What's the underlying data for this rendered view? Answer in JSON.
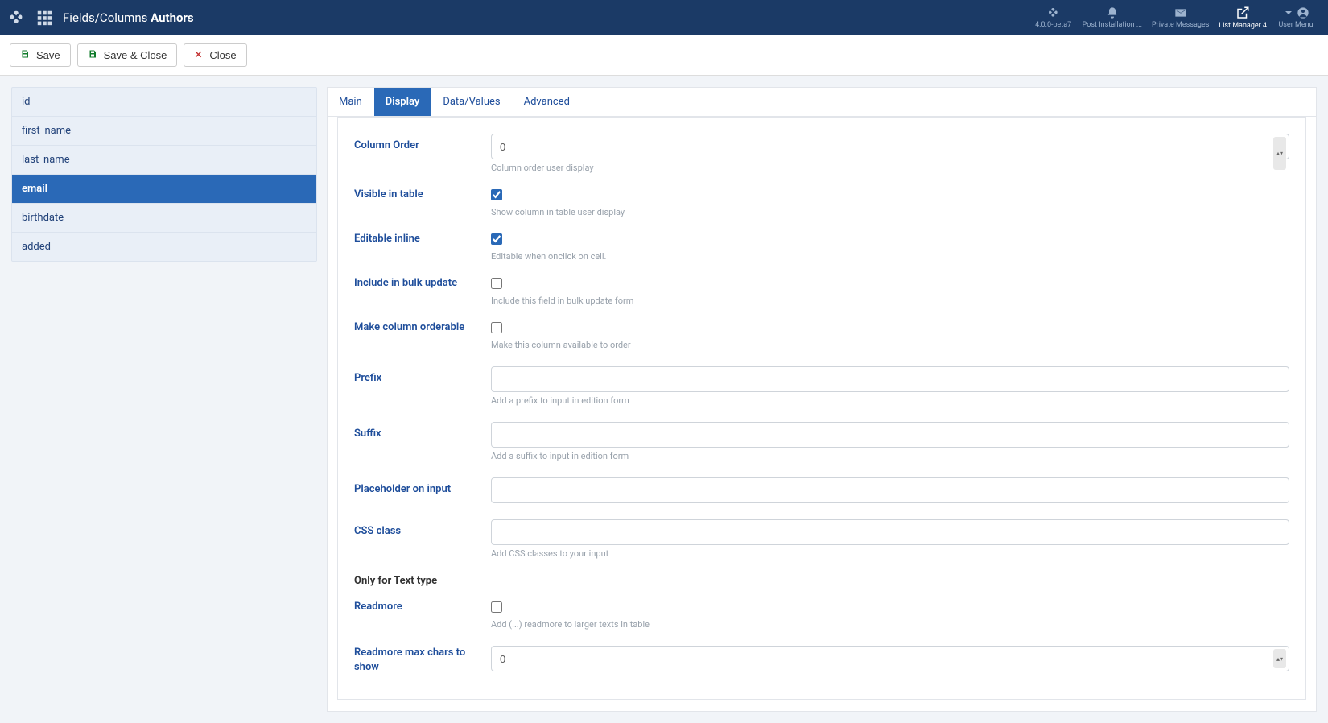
{
  "header": {
    "title_prefix": "Fields/Columns",
    "title_bold": "Authors"
  },
  "top_right": [
    {
      "icon": "joomla",
      "label": "4.0.0-beta7"
    },
    {
      "icon": "bell",
      "label": "Post Installation ..."
    },
    {
      "icon": "envelope",
      "label": "Private Messages"
    },
    {
      "icon": "open",
      "label": "List Manager 4",
      "active": true
    },
    {
      "icon": "user",
      "label": "User Menu"
    }
  ],
  "toolbar": {
    "save": "Save",
    "saveclose": "Save & Close",
    "close": "Close"
  },
  "sidebar": {
    "items": [
      {
        "label": "id",
        "active": false
      },
      {
        "label": "first_name",
        "active": false
      },
      {
        "label": "last_name",
        "active": false
      },
      {
        "label": "email",
        "active": true
      },
      {
        "label": "birthdate",
        "active": false
      },
      {
        "label": "added",
        "active": false
      }
    ]
  },
  "tabs": [
    {
      "label": "Main",
      "active": false
    },
    {
      "label": "Display",
      "active": true
    },
    {
      "label": "Data/Values",
      "active": false
    },
    {
      "label": "Advanced",
      "active": false
    }
  ],
  "form": {
    "column_order": {
      "label": "Column Order",
      "value": "0",
      "help": "Column order user display"
    },
    "visible": {
      "label": "Visible in table",
      "checked": true,
      "help": "Show column in table user display"
    },
    "editable": {
      "label": "Editable inline",
      "checked": true,
      "help": "Editable when onclick on cell."
    },
    "bulk": {
      "label": "Include in bulk update",
      "checked": false,
      "help": "Include this field in bulk update form"
    },
    "orderable": {
      "label": "Make column orderable",
      "checked": false,
      "help": "Make this column available to order"
    },
    "prefix": {
      "label": "Prefix",
      "value": "",
      "help": "Add a prefix to input in edition form"
    },
    "suffix": {
      "label": "Suffix",
      "value": "",
      "help": "Add a suffix to input in edition form"
    },
    "placeholder": {
      "label": "Placeholder on input",
      "value": ""
    },
    "cssclass": {
      "label": "CSS class",
      "value": "",
      "help": "Add CSS classes to your input"
    },
    "section_text": "Only for Text type",
    "readmore": {
      "label": "Readmore",
      "checked": false,
      "help": "Add (...) readmore to larger texts in table"
    },
    "readmore_max": {
      "label": "Readmore max chars to show",
      "value": "0"
    }
  }
}
